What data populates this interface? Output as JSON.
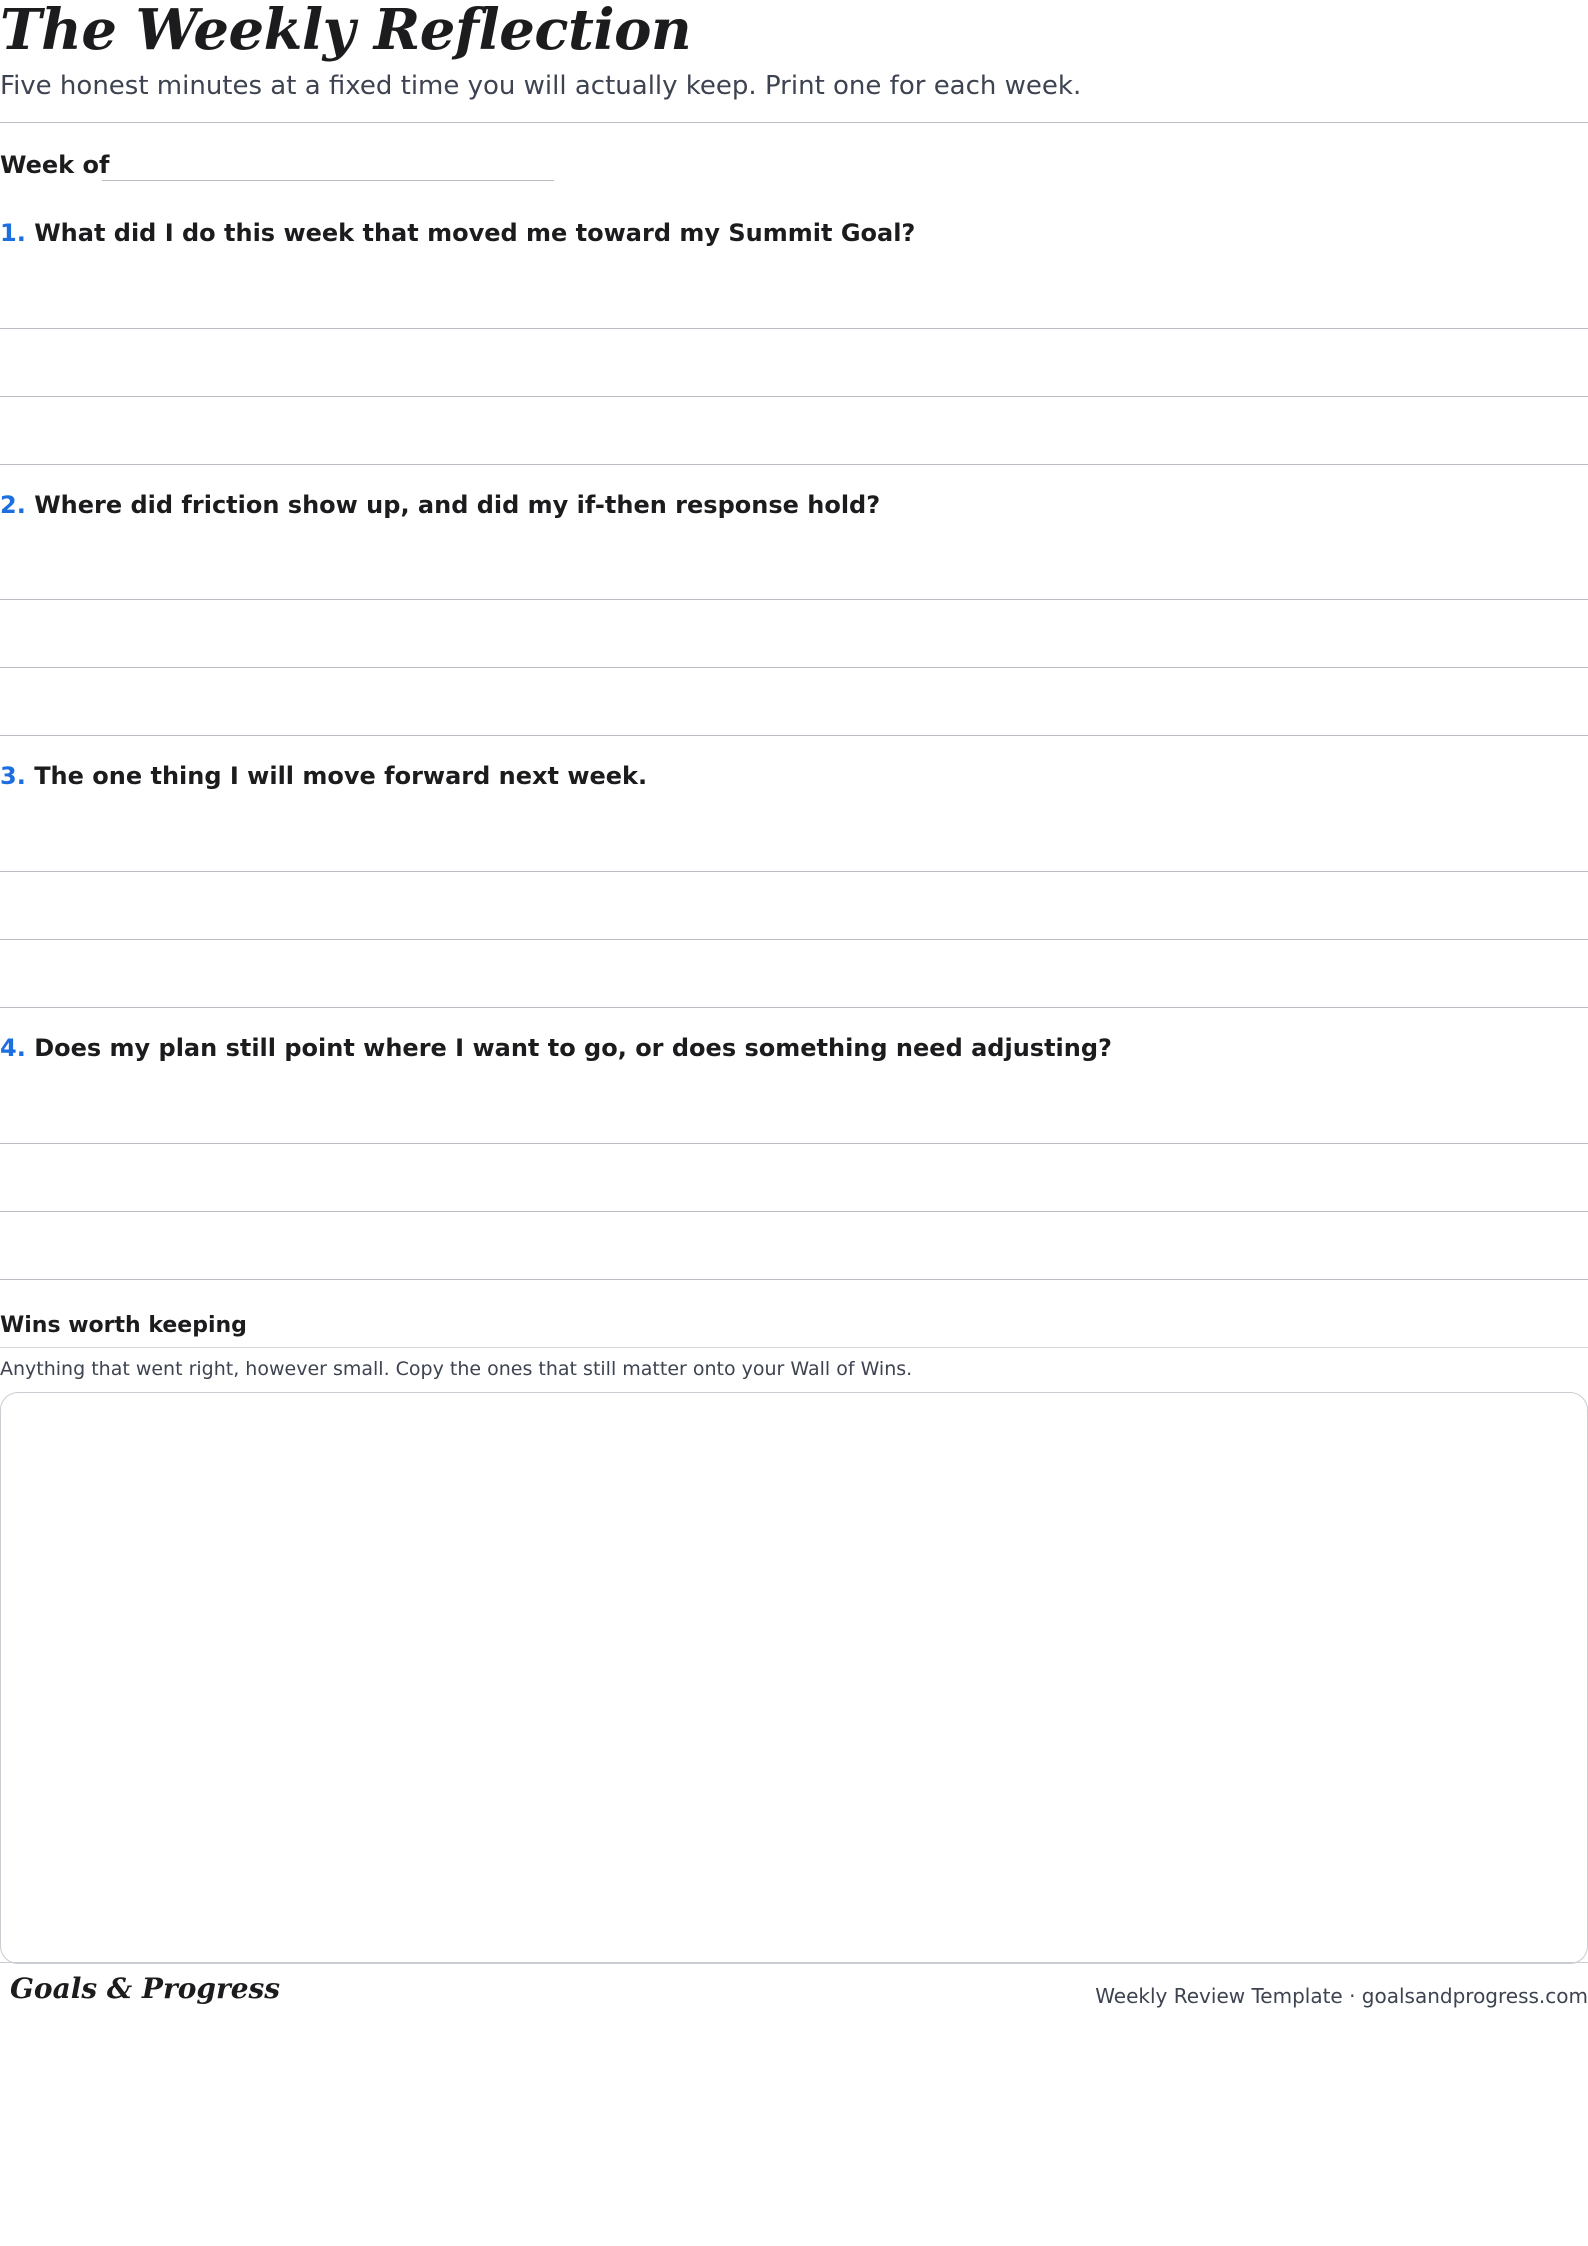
{
  "header": {
    "title": "The Weekly Reflection",
    "subtitle": "Five honest minutes at a fixed time you will actually keep. Print one for each week."
  },
  "week": {
    "label": "Week of",
    "value": ""
  },
  "questions": [
    {
      "number": "1.",
      "text": "What did I do this week that moved me toward my Summit Goal?"
    },
    {
      "number": "2.",
      "text": "Where did friction show up, and did my if-then response hold?"
    },
    {
      "number": "3.",
      "text": "The one thing I will move forward next week."
    },
    {
      "number": "4.",
      "text": "Does my plan still point where I want to go, or does something need adjusting?"
    }
  ],
  "wins": {
    "title": "Wins worth keeping",
    "description": "Anything that went right, however small. Copy the ones that still matter onto your Wall of Wins."
  },
  "footer": {
    "brand": "Goals & Progress",
    "note": "Weekly Review Template · goalsandprogress.com"
  },
  "colors": {
    "accent": "#1d6fe0",
    "text": "#1c1c1e",
    "muted": "#3d4350",
    "rule": "#b9bcc2"
  }
}
